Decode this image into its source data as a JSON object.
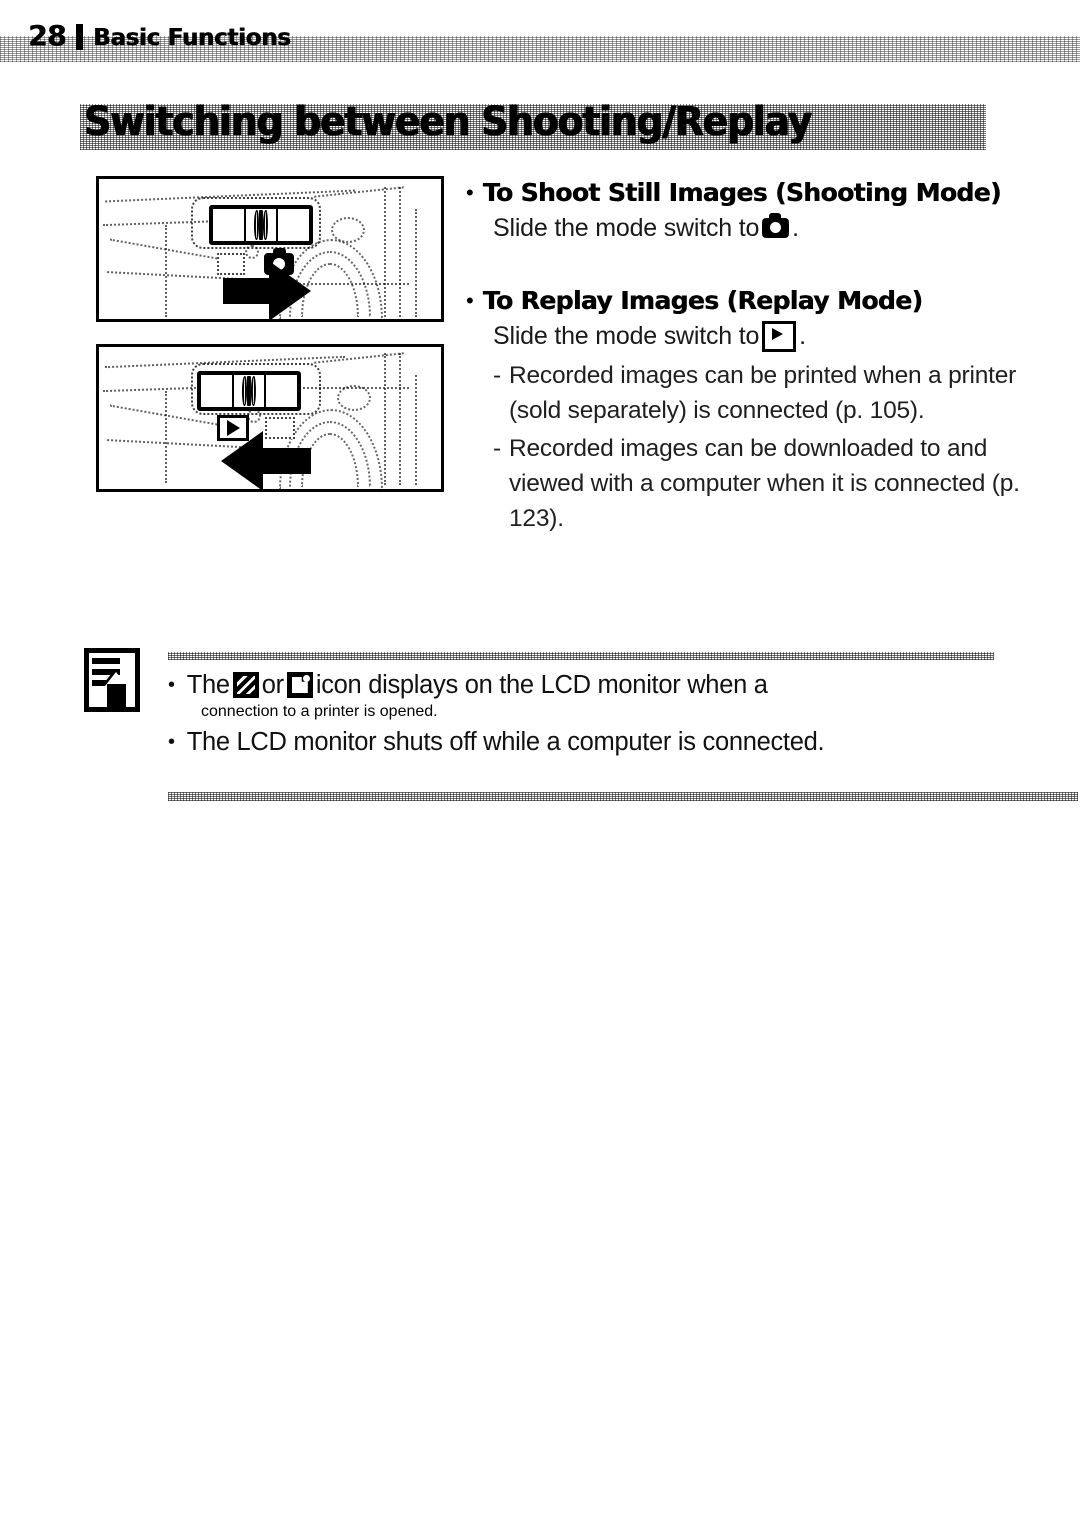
{
  "document": {
    "page_number": "28",
    "running_head": "Basic Functions",
    "section_title": "Switching between Shooting/Replay"
  },
  "figures": [
    {
      "name": "shooting-mode-switch-illustration",
      "caption_icon": "camera-icon",
      "arrow_direction": "right"
    },
    {
      "name": "replay-mode-switch-illustration",
      "caption_icon": "play-icon",
      "arrow_direction": "left"
    }
  ],
  "content": {
    "shooting": {
      "heading": "To Shoot Still Images (Shooting Mode)",
      "instruction_prefix": "Slide the mode switch to",
      "instruction_suffix": ".",
      "icon": "camera-icon"
    },
    "replay": {
      "heading": "To Replay Images (Replay Mode)",
      "instruction_prefix": "Slide the mode switch to",
      "instruction_suffix": ".",
      "icon": "play-icon",
      "sub_items": [
        {
          "dash": "-",
          "text": "Recorded images can be printed when a printer (sold separately) is connected (p. 105)."
        },
        {
          "dash": "-",
          "text": "Recorded images can be downloaded to and viewed with a computer when it is connected (p. 123)."
        }
      ]
    }
  },
  "note": {
    "icon": "memo-pencil-icon",
    "items": [
      {
        "bullet": "•",
        "text_before_icons": "The",
        "icon_1": "print-order-icon",
        "conjunction": "or",
        "icon_2": "print-transfer-icon",
        "text_after_icons": "icon displays on the LCD monitor when a",
        "continuation": "connection to a printer is opened."
      },
      {
        "bullet": "•",
        "text": "The LCD monitor shuts off while a computer is connected."
      }
    ]
  },
  "colors": {
    "ink": "#000000",
    "paper": "#ffffff",
    "texture": "#7a7a7a"
  }
}
